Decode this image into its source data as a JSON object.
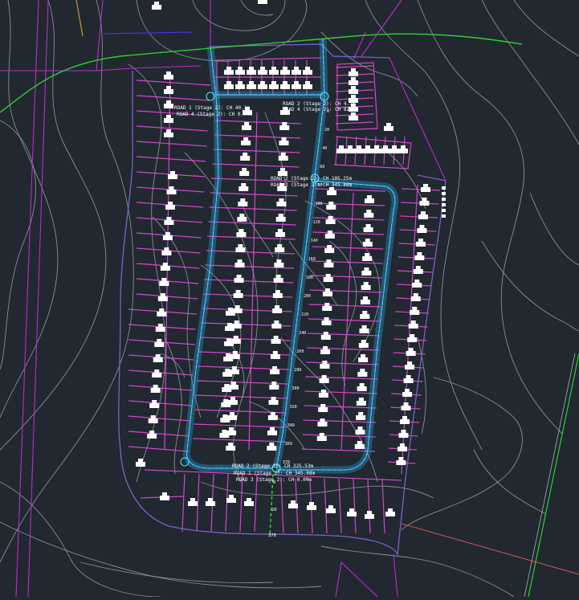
{
  "viewport": {
    "background": "#212830"
  },
  "colors": {
    "contour": "#a9b0b8",
    "boundary": "#c02ac6",
    "lot": "#e24ad8",
    "outline": "#7b62c8",
    "road": "#2fa7ea",
    "road_center": "#56e0ff",
    "highway": "#2fcf2f",
    "easement": "#d35a5a",
    "blue_line": "#3b38d8",
    "orange": "#c98a2a",
    "building": "#ffffff",
    "label": "#ffffff"
  },
  "chainage_labels": [
    {
      "id": "ch-road1-top",
      "text": "ROAD 1 (Stage 2): CH 40.1m"
    },
    {
      "id": "ch-road4-left",
      "text": "ROAD 4 (Stage 2): CH 0.00m"
    },
    {
      "id": "ch-road2-top",
      "text": "ROAD 2 (Stage 2): CH 4.7m"
    },
    {
      "id": "ch-road4-right",
      "text": "ROAD 4 (Stage 2): CH 82.0m"
    },
    {
      "id": "ch-road2-mid",
      "text": "ROAD 2 (Stage 2): CH 105.25m"
    },
    {
      "id": "ch-road3-mid",
      "text": "ROAD 3 (Stage 2): CH 345.40m"
    },
    {
      "id": "ch-road2-bot",
      "text": "ROAD 2 (Stage 2): CH 325.53m"
    },
    {
      "id": "ch-road1-bot",
      "text": "ROAD 1 (Stage 2): CH 345.08m"
    },
    {
      "id": "ch-road3-bot",
      "text": "ROAD 3 (Stage 2): CH 0.00m"
    }
  ],
  "stations": [
    "0",
    "20",
    "40",
    "60",
    "80",
    "100",
    "120",
    "140",
    "160",
    "180",
    "200",
    "220",
    "240",
    "260",
    "280",
    "300",
    "320",
    "340",
    "360",
    "378"
  ]
}
